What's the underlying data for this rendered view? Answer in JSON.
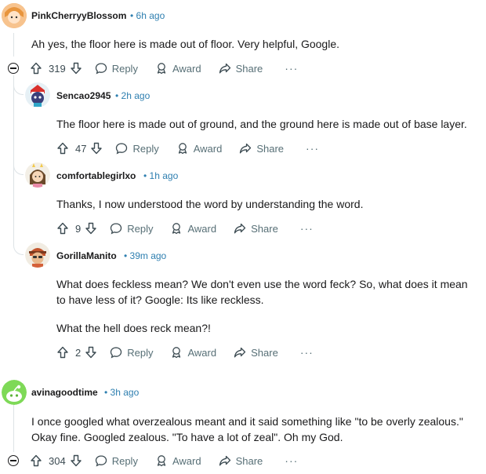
{
  "comments": [
    {
      "username": "PinkCherryyBlossom",
      "time": "• 6h ago",
      "body": [
        "Ah yes, the floor here is made out of floor. Very helpful, Google."
      ],
      "votes": "319",
      "reply": "Reply",
      "award": "Award",
      "share": "Share",
      "more": "···"
    },
    {
      "username": "Sencao2945",
      "time": "• 2h ago",
      "body": [
        "The floor here is made out of ground, and the ground here is made out of base layer."
      ],
      "votes": "47",
      "reply": "Reply",
      "award": "Award",
      "share": "Share",
      "more": "···"
    },
    {
      "username": "comfortablegirlxo",
      "time": "• 1h ago",
      "body": [
        "Thanks, I now understood the word by understanding the word."
      ],
      "votes": "9",
      "reply": "Reply",
      "award": "Award",
      "share": "Share",
      "more": "···"
    },
    {
      "username": "GorillaManito",
      "time": "• 39m ago",
      "body": [
        "What does feckless mean? We don't even use the word feck? So, what does it mean to have less of it? Google: Its like reckless.",
        "What the hell does reck mean?!"
      ],
      "votes": "2",
      "reply": "Reply",
      "award": "Award",
      "share": "Share",
      "more": "···"
    },
    {
      "username": "avinagoodtime",
      "time": "• 3h ago",
      "body": [
        "I once googled what overzealous meant and it said something like \"to be overly zealous.\" Okay fine. Googled zealous. \"To have a lot of zeal\". Oh my God."
      ],
      "votes": "304",
      "reply": "Reply",
      "award": "Award",
      "share": "Share",
      "more": "···"
    }
  ],
  "colors": {
    "time": "#2e7fb0",
    "action": "#576f76",
    "thread_line": "#dde3e6"
  }
}
